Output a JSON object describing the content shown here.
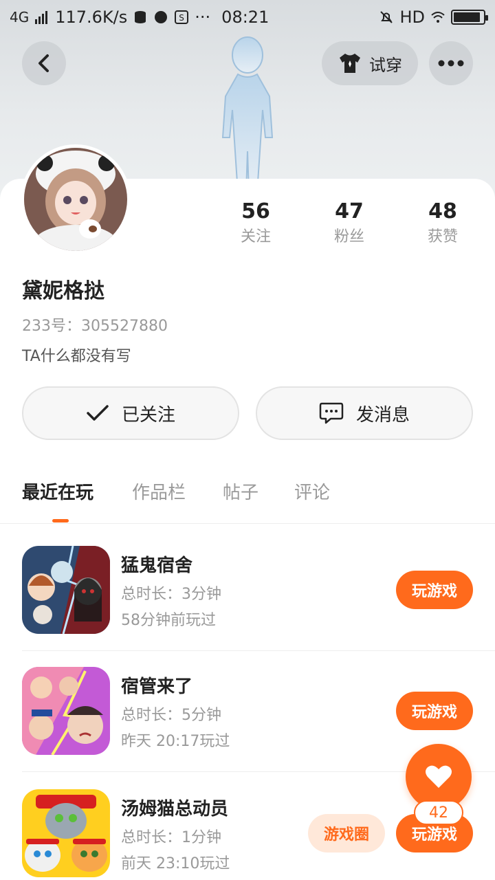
{
  "status_bar": {
    "network": "4G",
    "speed": "117.6K/s",
    "time": "08:21",
    "hd": "HD",
    "dots": "···"
  },
  "header": {
    "try_on_label": "试穿"
  },
  "profile": {
    "name": "黛妮格挞",
    "uid": "233号：305527880",
    "bio": "TA什么都没有写"
  },
  "stats": [
    {
      "value": "56",
      "label": "关注"
    },
    {
      "value": "47",
      "label": "粉丝"
    },
    {
      "value": "48",
      "label": "获赞"
    }
  ],
  "actions": {
    "follow_label": "已关注",
    "message_label": "发消息"
  },
  "tabs": [
    "最近在玩",
    "作品栏",
    "帖子",
    "评论"
  ],
  "games": [
    {
      "title": "猛鬼宿舍",
      "duration": "总时长：3分钟",
      "last_played": "58分钟前玩过",
      "play_label": "玩游戏"
    },
    {
      "title": "宿管来了",
      "duration": "总时长：5分钟",
      "last_played": "昨天 20:17玩过",
      "play_label": "玩游戏"
    },
    {
      "title": "汤姆猫总动员",
      "duration": "总时长：1分钟",
      "last_played": "前天 23:10玩过",
      "play_label": "玩游戏",
      "circle_label": "游戏圈"
    }
  ],
  "like_fab": {
    "count": "42"
  },
  "colors": {
    "accent": "#ff6a1c",
    "accent_light": "#ffe8d9"
  }
}
